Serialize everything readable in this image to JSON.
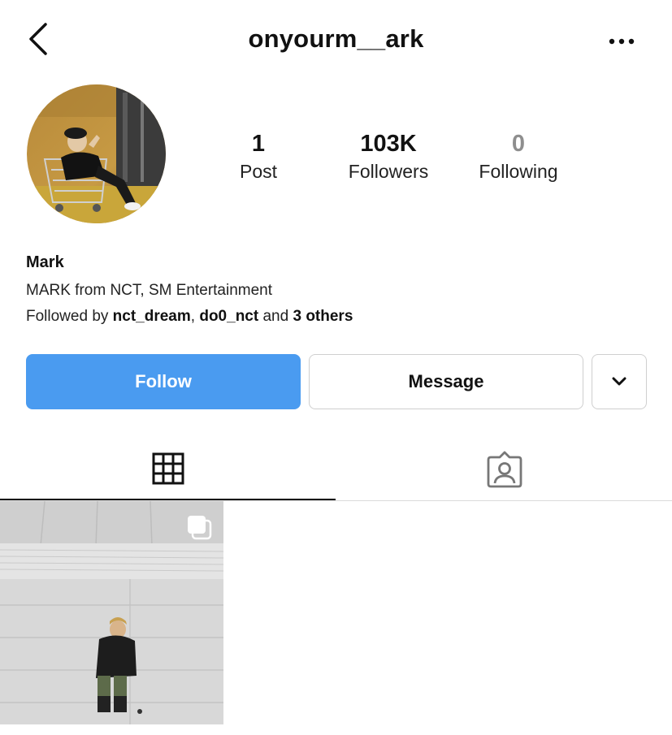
{
  "header": {
    "username": "onyourm__ark",
    "back_icon": "chevron-left-icon",
    "more_icon": "more-horizontal-icon"
  },
  "profile": {
    "stats": [
      {
        "value": "1",
        "label": "Post"
      },
      {
        "value": "103K",
        "label": "Followers"
      },
      {
        "value": "0",
        "label": "Following"
      }
    ],
    "name": "Mark",
    "bio": "MARK from NCT, SM Entertainment",
    "followed_by": {
      "prefix": "Followed by ",
      "user1": "nct_dream",
      "sep": ", ",
      "user2": "do0_nct",
      "and": " and ",
      "others": "3 others"
    }
  },
  "actions": {
    "follow_label": "Follow",
    "message_label": "Message",
    "dropdown_icon": "chevron-down-icon",
    "accent_color": "#4a9bf0"
  },
  "tabs": [
    {
      "name": "posts",
      "icon": "grid-icon",
      "active": true
    },
    {
      "name": "tagged",
      "icon": "tagged-person-icon",
      "active": false
    }
  ],
  "posts": [
    {
      "type": "carousel",
      "icon": "multiple-posts-icon"
    }
  ]
}
